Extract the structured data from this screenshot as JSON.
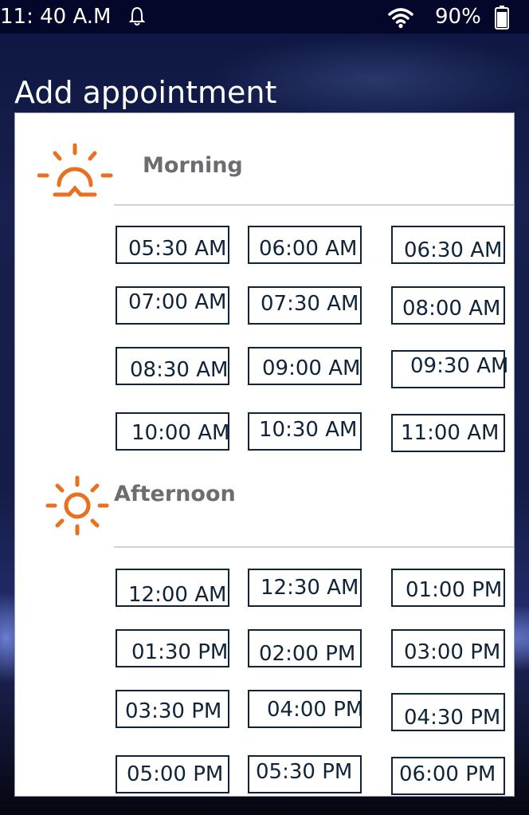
{
  "status_bar": {
    "time": "11: 40 A.M",
    "battery": "90%",
    "icons": [
      "bell-icon",
      "wifi-icon",
      "battery-icon"
    ]
  },
  "screen_title": "Add appointment",
  "colors": {
    "accent": "#e8701f",
    "slot_border": "#0f2438",
    "section_label": "#6b6d70",
    "status_bar_bg": "#05072a"
  },
  "sections": {
    "morning": {
      "label": "Morning",
      "icon": "sunrise-icon",
      "slots": [
        "05:30 AM",
        "06:00 AM",
        "06:30 AM",
        "07:00 AM",
        "07:30 AM",
        "08:00 AM",
        "08:30 AM",
        "09:00 AM",
        "09:30 AM",
        "10:00 AM",
        "10:30 AM",
        "11:00 AM"
      ]
    },
    "afternoon": {
      "label": "Afternoon",
      "icon": "sun-icon",
      "slots": [
        "12:00 AM",
        "12:30 AM",
        "01:00 PM",
        "01:30 PM",
        "02:00 PM",
        "03:00 PM",
        "03:30 PM",
        "04:00 PM",
        "04:30 PM",
        "05:00 PM",
        "05:30 PM",
        "06:00 PM"
      ]
    }
  }
}
